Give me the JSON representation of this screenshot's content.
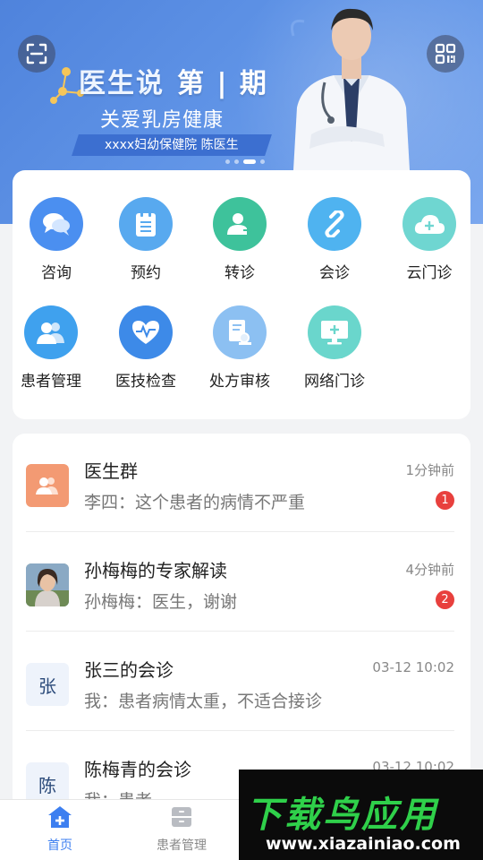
{
  "banner": {
    "title_main": "医生说",
    "title_issue": "第 | 期",
    "subtitle": "关爱乳房健康",
    "tag": "xxxx妇幼保健院   陈医生",
    "slide_count": 4,
    "active_slide": 3
  },
  "features": [
    {
      "label": "咨询",
      "icon": "chat-bubbles-icon",
      "color": "#4b8ff0"
    },
    {
      "label": "预约",
      "icon": "clipboard-icon",
      "color": "#58a9ef"
    },
    {
      "label": "转诊",
      "icon": "user-transfer-icon",
      "color": "#3ec29b"
    },
    {
      "label": "会诊",
      "icon": "link-icon",
      "color": "#4fb3f0"
    },
    {
      "label": "云门诊",
      "icon": "cloud-plus-icon",
      "color": "#6fd6d1"
    },
    {
      "label": "患者管理",
      "icon": "users-icon",
      "color": "#3fa1ee"
    },
    {
      "label": "医技检查",
      "icon": "heart-pulse-icon",
      "color": "#3d8ae8"
    },
    {
      "label": "处方审核",
      "icon": "prescription-icon",
      "color": "#8cc0f2"
    },
    {
      "label": "网络门诊",
      "icon": "monitor-plus-icon",
      "color": "#6ad6cc"
    }
  ],
  "messages": [
    {
      "name": "医生群",
      "preview": "李四：这个患者的病情不严重",
      "time": "1分钟前",
      "badge": "1",
      "avatar_type": "group-icon"
    },
    {
      "name": "孙梅梅的专家解读",
      "preview": "孙梅梅：医生，谢谢",
      "time": "4分钟前",
      "badge": "2",
      "avatar_type": "photo"
    },
    {
      "name": "张三的会诊",
      "preview": "我：患者病情太重，不适合接诊",
      "time": "03-12 10:02",
      "badge": "",
      "avatar_text": "张"
    },
    {
      "name": "陈梅青的会诊",
      "preview": "我：患者",
      "time": "03-12 10:02",
      "badge": "",
      "avatar_text": "陈"
    }
  ],
  "nav": {
    "home": "首页",
    "patients": "患者管理",
    "active_color": "#3d7ff0"
  },
  "watermark": {
    "title": "下载鸟应用",
    "url": "www.xiazainiao.com"
  }
}
